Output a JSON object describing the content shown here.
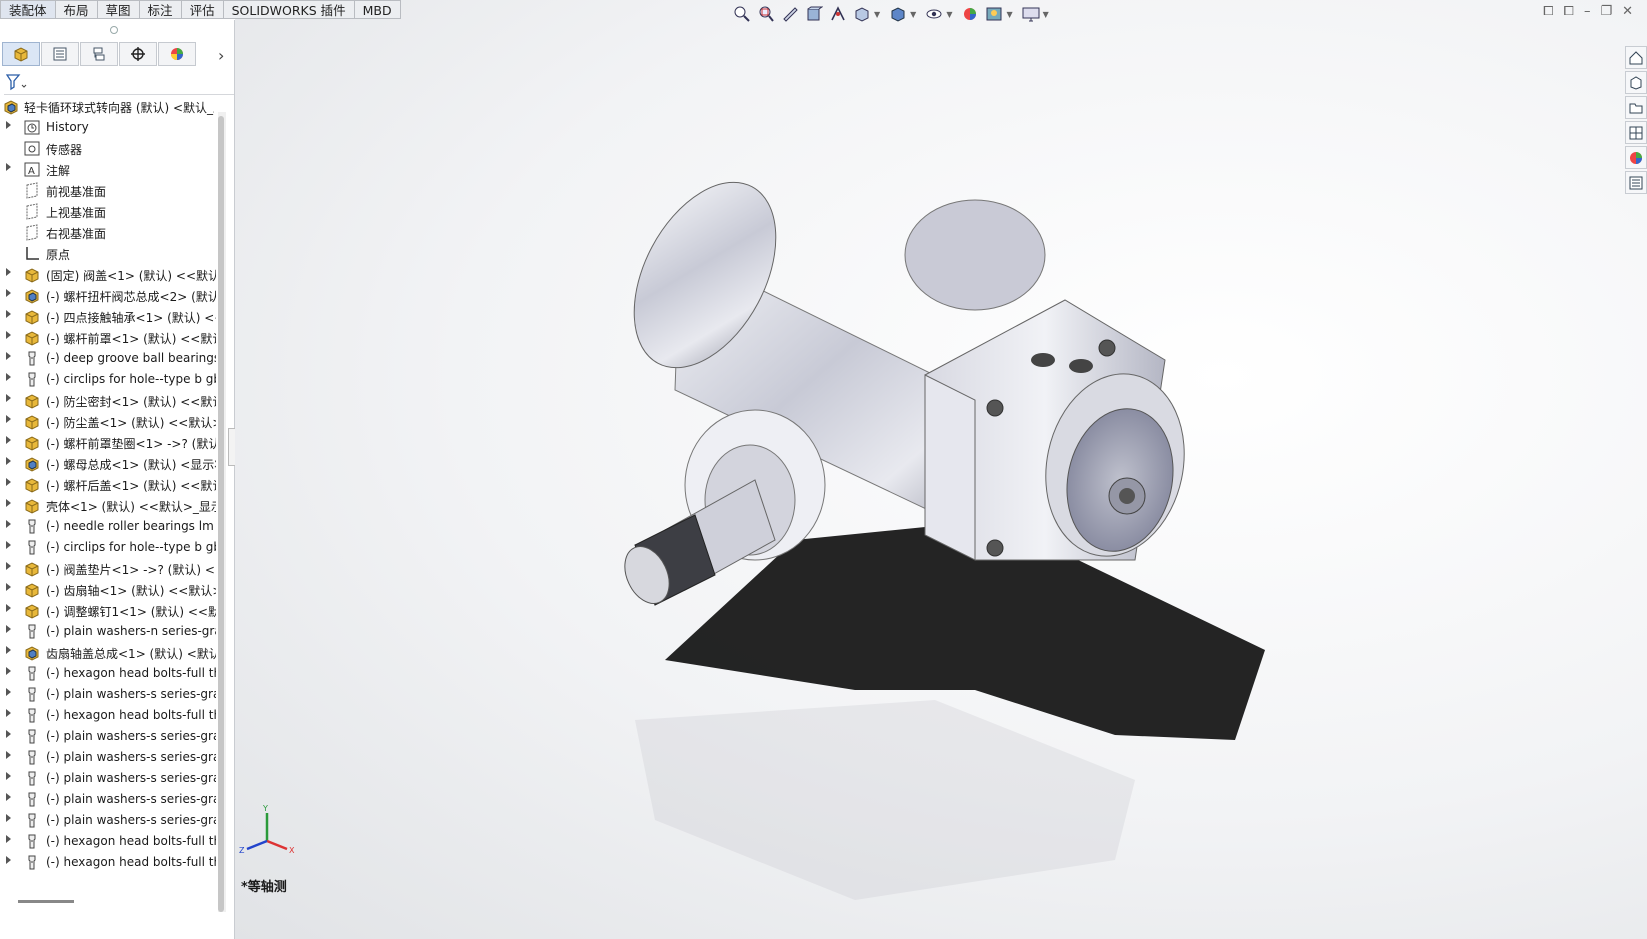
{
  "command_tabs": [
    "装配体",
    "布局",
    "草图",
    "标注",
    "评估",
    "SOLIDWORKS 插件",
    "MBD"
  ],
  "panel_tabs": [
    "feature-manager-icon",
    "property-manager-icon",
    "configuration-manager-icon",
    "dimxpert-icon",
    "display-manager-icon"
  ],
  "tree": {
    "root": "轻卡循环球式转向器 (默认) <默认_显",
    "items": [
      {
        "label": "History",
        "icon": "history-icon",
        "expand": true
      },
      {
        "label": "传感器",
        "icon": "sensor-icon",
        "expand": false
      },
      {
        "label": "注解",
        "icon": "annotation-icon",
        "expand": true
      },
      {
        "label": "前视基准面",
        "icon": "plane-icon",
        "expand": false
      },
      {
        "label": "上视基准面",
        "icon": "plane-icon",
        "expand": false
      },
      {
        "label": "右视基准面",
        "icon": "plane-icon",
        "expand": false
      },
      {
        "label": "原点",
        "icon": "origin-icon",
        "expand": false
      },
      {
        "label": "(固定) 阀盖<1> (默认) <<默认>",
        "icon": "part-icon",
        "expand": true
      },
      {
        "label": "(-) 螺杆扭杆阀芯总成<2> (默认)",
        "icon": "subassembly-icon",
        "expand": true
      },
      {
        "label": "(-) 四点接触轴承<1> (默认) <<!",
        "icon": "part-icon",
        "expand": true
      },
      {
        "label": "(-) 螺杆前罩<1> (默认) <<默认",
        "icon": "part-icon",
        "expand": true
      },
      {
        "label": "(-) deep groove ball bearings",
        "icon": "toolbox-icon",
        "expand": true
      },
      {
        "label": "(-) circlips for hole--type b gb",
        "icon": "toolbox-icon",
        "expand": true
      },
      {
        "label": "(-) 防尘密封<1> (默认) <<默认",
        "icon": "part-icon",
        "expand": true
      },
      {
        "label": "(-) 防尘盖<1> (默认) <<默认>_",
        "icon": "part-icon",
        "expand": true
      },
      {
        "label": "(-) 螺杆前罩垫圈<1> ->? (默认)",
        "icon": "part-icon",
        "expand": true
      },
      {
        "label": "(-) 螺母总成<1> (默认) <显示状",
        "icon": "subassembly-icon",
        "expand": true
      },
      {
        "label": "(-) 螺杆后盖<1> (默认) <<默认",
        "icon": "part-icon",
        "expand": true
      },
      {
        "label": "壳体<1> (默认) <<默认>_显示状",
        "icon": "part-icon",
        "expand": true
      },
      {
        "label": "(-) needle roller bearings lm s",
        "icon": "toolbox-icon",
        "expand": true
      },
      {
        "label": "(-) circlips for hole--type b gb",
        "icon": "toolbox-icon",
        "expand": true
      },
      {
        "label": "(-) 阀盖垫片<1> ->? (默认) <<!",
        "icon": "part-icon",
        "expand": true
      },
      {
        "label": "(-) 齿扇轴<1> (默认) <<默认>_",
        "icon": "part-icon",
        "expand": true
      },
      {
        "label": "(-) 调整螺钉1<1> (默认) <<默认",
        "icon": "part-icon",
        "expand": true
      },
      {
        "label": "(-) plain washers-n series-grac",
        "icon": "toolbox-icon",
        "expand": true
      },
      {
        "label": "齿扇轴盖总成<1> (默认) <默认_",
        "icon": "subassembly-icon",
        "expand": true
      },
      {
        "label": "(-) hexagon head bolts-full thr",
        "icon": "toolbox-icon",
        "expand": true
      },
      {
        "label": "(-) plain washers-s series-grac",
        "icon": "toolbox-icon",
        "expand": true
      },
      {
        "label": "(-) hexagon head bolts-full thr",
        "icon": "toolbox-icon",
        "expand": true
      },
      {
        "label": "(-) plain washers-s series-grac",
        "icon": "toolbox-icon",
        "expand": true
      },
      {
        "label": "(-) plain washers-s series-grac",
        "icon": "toolbox-icon",
        "expand": true
      },
      {
        "label": "(-) plain washers-s series-grac",
        "icon": "toolbox-icon",
        "expand": true
      },
      {
        "label": "(-) plain washers-s series-grac",
        "icon": "toolbox-icon",
        "expand": true
      },
      {
        "label": "(-) plain washers-s series-grac",
        "icon": "toolbox-icon",
        "expand": true
      },
      {
        "label": "(-) hexagon head bolts-full thr",
        "icon": "toolbox-icon",
        "expand": true
      },
      {
        "label": "(-) hexagon head bolts-full thr",
        "icon": "toolbox-icon",
        "expand": true
      }
    ]
  },
  "viewport": {
    "view_name": "*等轴测",
    "triad_axes": {
      "y": "Y",
      "x": "X",
      "z": "Z"
    }
  },
  "colors": {
    "part_yellow": "#e8b83a",
    "subasm_blue": "#4f7fc4",
    "viewport_bg": "#eef0f2"
  }
}
